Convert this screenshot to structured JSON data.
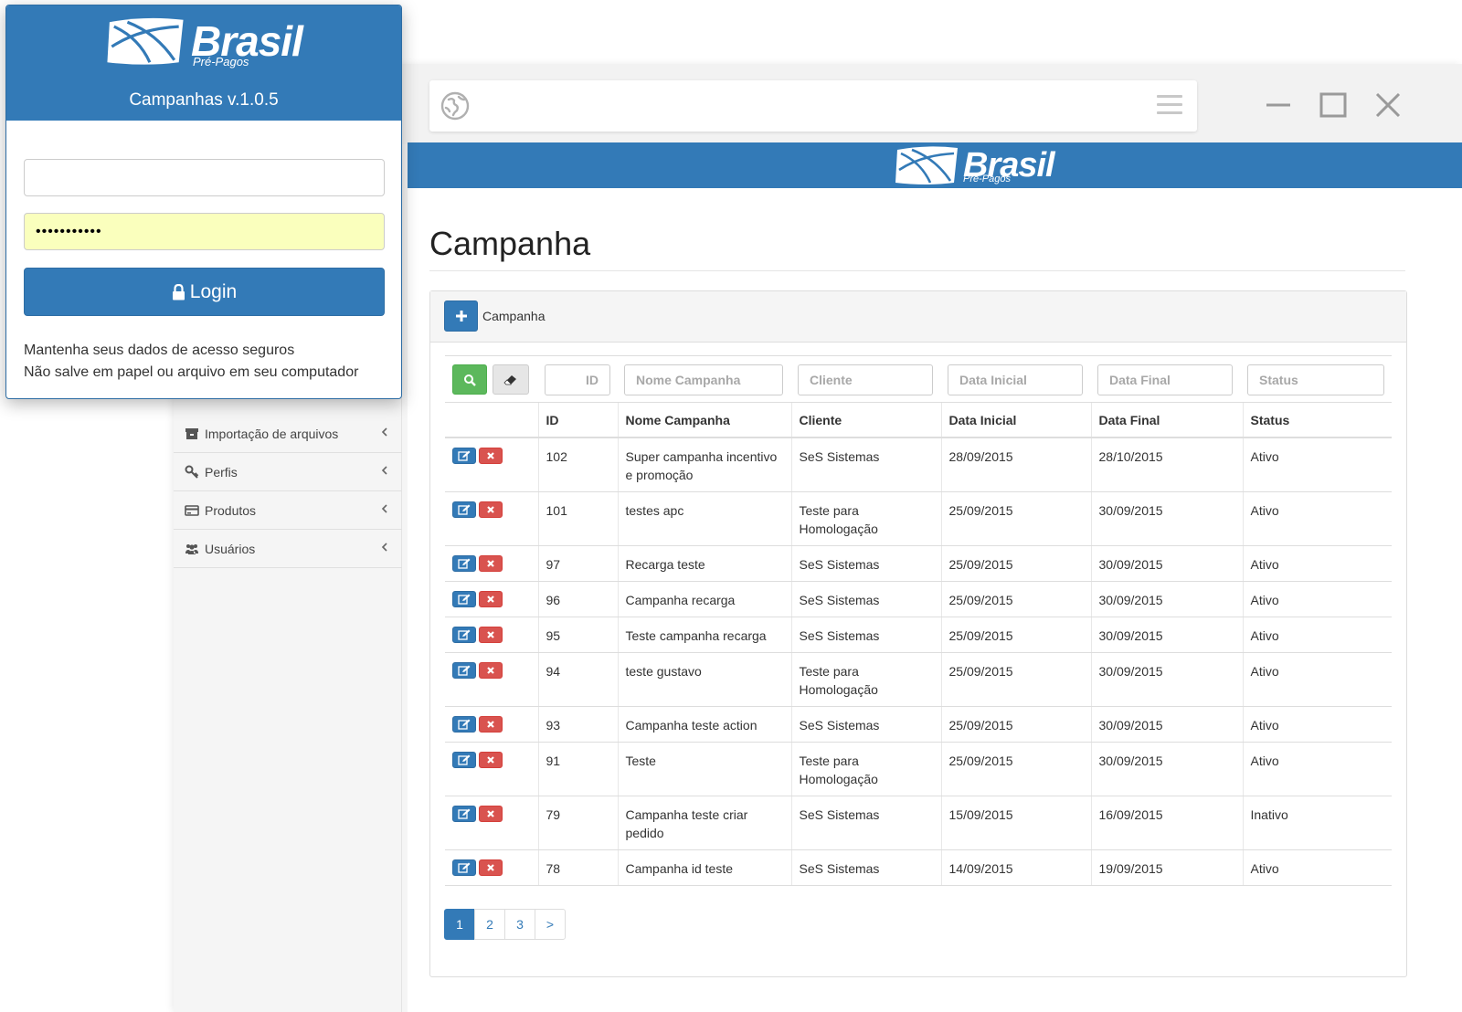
{
  "login": {
    "brand_name": "Brasil",
    "brand_sub": "Pré-Pagos",
    "title": "Campanhas v.1.0.5",
    "username_value": "",
    "password_value": "•••••••••••",
    "login_label": "Login",
    "note_line1": "Mantenha seus dados de acesso seguros",
    "note_line2": "Não salve em papel ou arquivo em seu computador"
  },
  "app": {
    "brand_name": "Brasil",
    "brand_sub": "Pré-Pagos",
    "page_title": "Campanha",
    "panel_label": "Campanha",
    "colors": {
      "primary": "#337ab7",
      "success": "#5cb85c",
      "danger": "#d9534f"
    }
  },
  "sidebar": {
    "items": [
      {
        "label": "Importação de arquivos",
        "icon": "archive-icon"
      },
      {
        "label": "Perfis",
        "icon": "key-icon"
      },
      {
        "label": "Produtos",
        "icon": "credit-card-icon"
      },
      {
        "label": "Usuários",
        "icon": "users-icon"
      }
    ]
  },
  "filters": {
    "id": "ID",
    "nome": "Nome Campanha",
    "cliente": "Cliente",
    "data_inicial": "Data Inicial",
    "data_final": "Data Final",
    "status": "Status"
  },
  "table": {
    "headers": [
      "ID",
      "Nome Campanha",
      "Cliente",
      "Data Inicial",
      "Data Final",
      "Status"
    ],
    "rows": [
      [
        "102",
        "Super campanha incentivo e promoção",
        "SeS Sistemas",
        "28/09/2015",
        "28/10/2015",
        "Ativo"
      ],
      [
        "101",
        "testes apc",
        "Teste para Homologação",
        "25/09/2015",
        "30/09/2015",
        "Ativo"
      ],
      [
        "97",
        "Recarga teste",
        "SeS Sistemas",
        "25/09/2015",
        "30/09/2015",
        "Ativo"
      ],
      [
        "96",
        "Campanha recarga",
        "SeS Sistemas",
        "25/09/2015",
        "30/09/2015",
        "Ativo"
      ],
      [
        "95",
        "Teste campanha recarga",
        "SeS Sistemas",
        "25/09/2015",
        "30/09/2015",
        "Ativo"
      ],
      [
        "94",
        "teste gustavo",
        "Teste para Homologação",
        "25/09/2015",
        "30/09/2015",
        "Ativo"
      ],
      [
        "93",
        "Campanha teste action",
        "SeS Sistemas",
        "25/09/2015",
        "30/09/2015",
        "Ativo"
      ],
      [
        "91",
        "Teste",
        "Teste para Homologação",
        "25/09/2015",
        "30/09/2015",
        "Ativo"
      ],
      [
        "79",
        "Campanha teste criar pedido",
        "SeS Sistemas",
        "15/09/2015",
        "16/09/2015",
        "Inativo"
      ],
      [
        "78",
        "Campanha id teste",
        "SeS Sistemas",
        "14/09/2015",
        "19/09/2015",
        "Ativo"
      ]
    ]
  },
  "pagination": {
    "pages": [
      "1",
      "2",
      "3"
    ],
    "next": ">",
    "active": "1"
  }
}
